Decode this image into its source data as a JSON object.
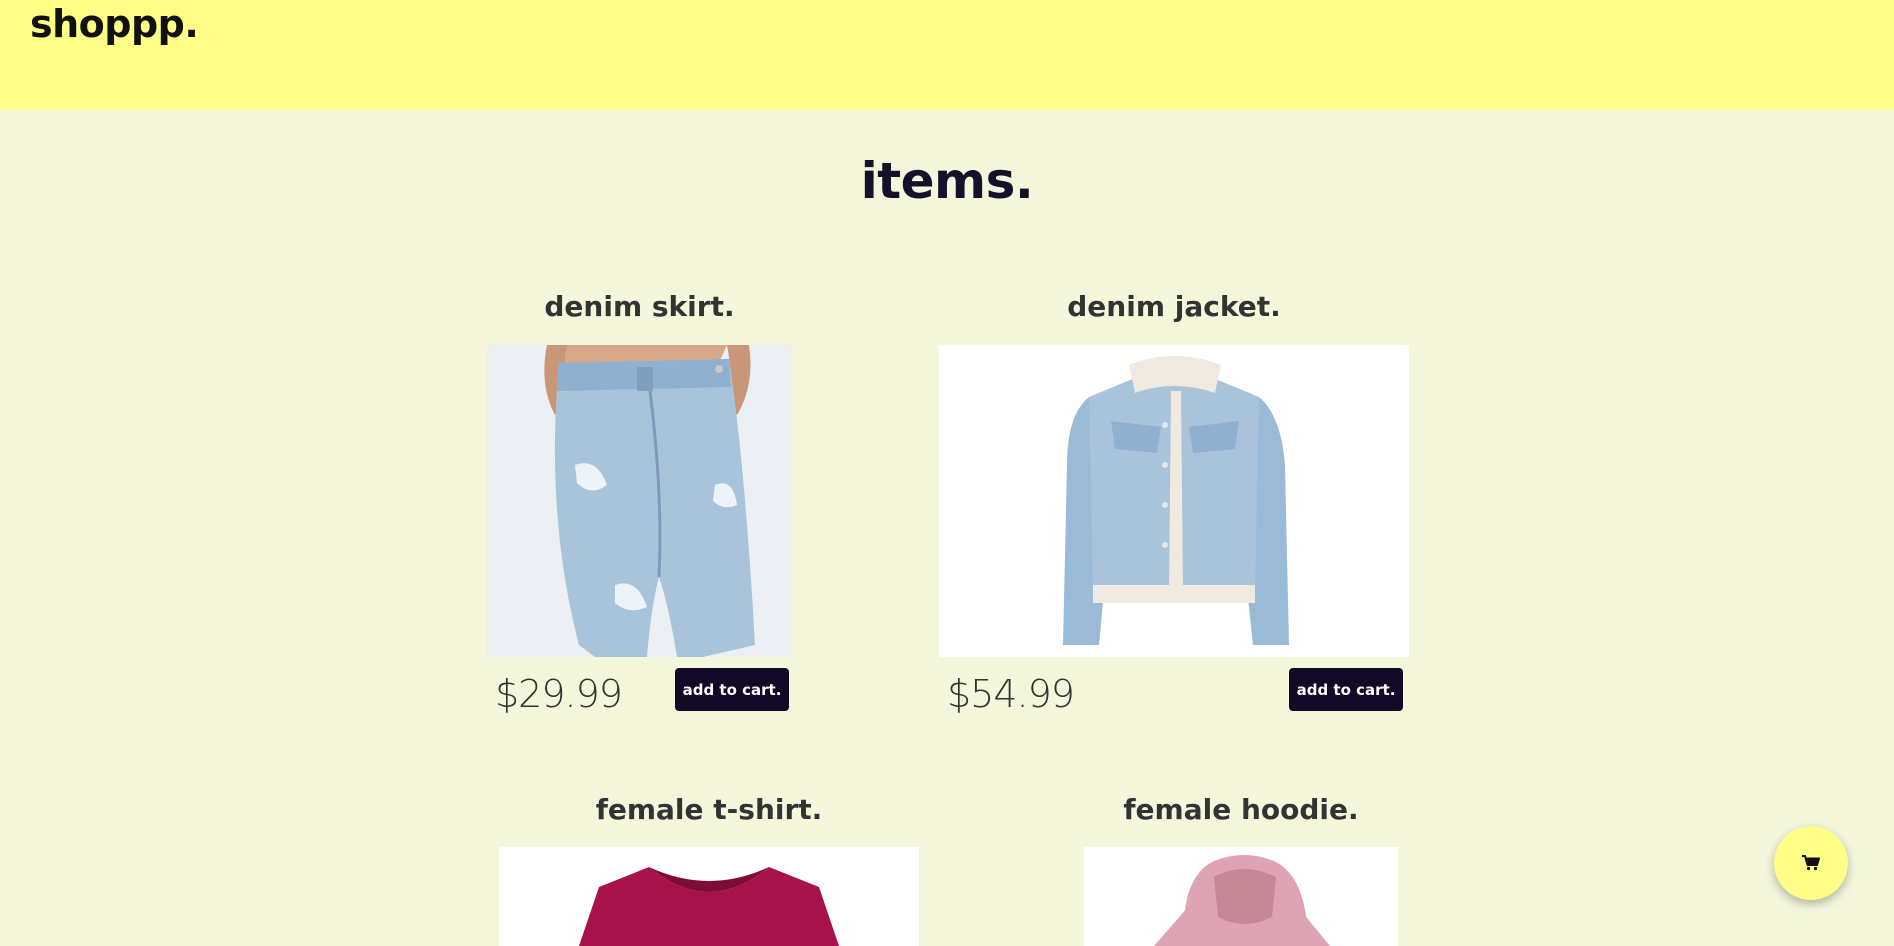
{
  "header": {
    "brand": "shoppp."
  },
  "main": {
    "title": "items."
  },
  "products": [
    {
      "name": "denim skirt.",
      "price": "$29.99",
      "button": "add to cart."
    },
    {
      "name": "denim jacket.",
      "price": "$54.99",
      "button": "add to cart."
    },
    {
      "name": "female t-shirt.",
      "price": "",
      "button": ""
    },
    {
      "name": "female hoodie.",
      "price": "",
      "button": ""
    }
  ],
  "cart": {
    "icon": "shopping-cart-icon"
  },
  "colors": {
    "header_bg": "#ffff88",
    "page_bg": "#f4f7dc",
    "button_bg": "#120926",
    "denim": "#a9c3db",
    "tshirt": "#a8124a",
    "hoodie": "#dfa4b3"
  }
}
